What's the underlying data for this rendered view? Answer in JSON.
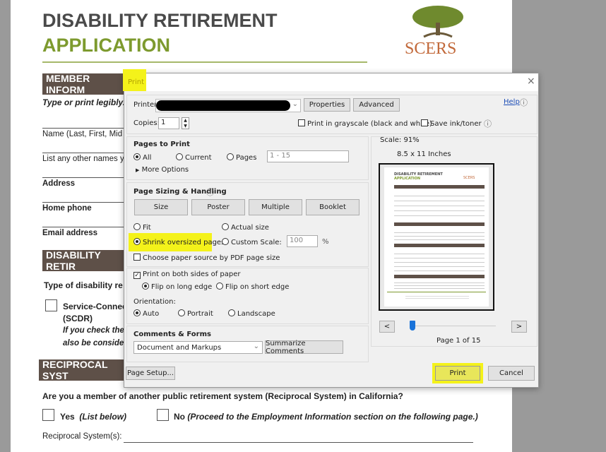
{
  "document": {
    "title_line1": "DISABILITY RETIREMENT",
    "title_line2": "APPLICATION",
    "logo_text": "SCERS",
    "section_member": "MEMBER INFORM",
    "instructions": "Type or print legibly.",
    "field_name": "Name (Last, First, Mid",
    "field_other_names": "List any other names y",
    "field_address": "Address",
    "field_home_phone": "Home phone",
    "field_email": "Email address",
    "section_disability": "DISABILITY RETIR",
    "type_of_disability": "Type of disability re",
    "option_scdr_line1": "Service-Connec",
    "option_scdr_line2": "(SCDR)",
    "scdr_note_line1": "If you check the",
    "scdr_note_line2": "also be conside",
    "section_reciprocal": "RECIPROCAL SYST",
    "reciprocal_question": "Are you a member of another public retirement system (Reciprocal System) in California?",
    "yes_label": "Yes",
    "yes_note": "(List below)",
    "no_label": "No",
    "no_note": "(Proceed to the Employment Information section on the following page.)",
    "reciprocal_systems_label": "Reciprocal System(s):"
  },
  "dialog": {
    "title": "Print",
    "close": "×",
    "printer_label": "Printer",
    "properties": "Properties",
    "advanced": "Advanced",
    "help": "Help",
    "copies_label": "Copies:",
    "copies_value": "1",
    "grayscale": "Print in grayscale (black and white)",
    "save_ink": "Save ink/toner",
    "pages_to_print": {
      "title": "Pages to Print",
      "all": "All",
      "current": "Current",
      "pages": "Pages",
      "pages_value": "1 - 15",
      "more_options": "More Options",
      "selected": "All"
    },
    "sizing": {
      "title": "Page Sizing & Handling",
      "size": "Size",
      "poster": "Poster",
      "multiple": "Multiple",
      "booklet": "Booklet",
      "fit": "Fit",
      "actual": "Actual size",
      "shrink": "Shrink oversized pages",
      "custom": "Custom Scale:",
      "custom_value": "100",
      "percent": "%",
      "paper_source": "Choose paper source by PDF page size",
      "both_sides": "Print on both sides of paper",
      "long_edge": "Flip on long edge",
      "short_edge": "Flip on short edge",
      "orientation": "Orientation:",
      "auto": "Auto",
      "portrait": "Portrait",
      "landscape": "Landscape",
      "selected": "Shrink oversized pages"
    },
    "comments": {
      "title": "Comments & Forms",
      "value": "Document and Markups",
      "summarize": "Summarize Comments"
    },
    "page_setup": "Page Setup...",
    "preview": {
      "scale": "Scale: 91%",
      "paper": "8.5 x 11 Inches",
      "prev": "<",
      "next": ">",
      "page_indicator": "Page 1 of 15",
      "slider_position": 0.0,
      "thumb_title1": "DISABILITY RETIREMENT",
      "thumb_title2": "APPLICATION",
      "thumb_logo": "SCERS"
    },
    "print": "Print",
    "cancel": "Cancel",
    "highlight_color": "#f4f21a"
  }
}
